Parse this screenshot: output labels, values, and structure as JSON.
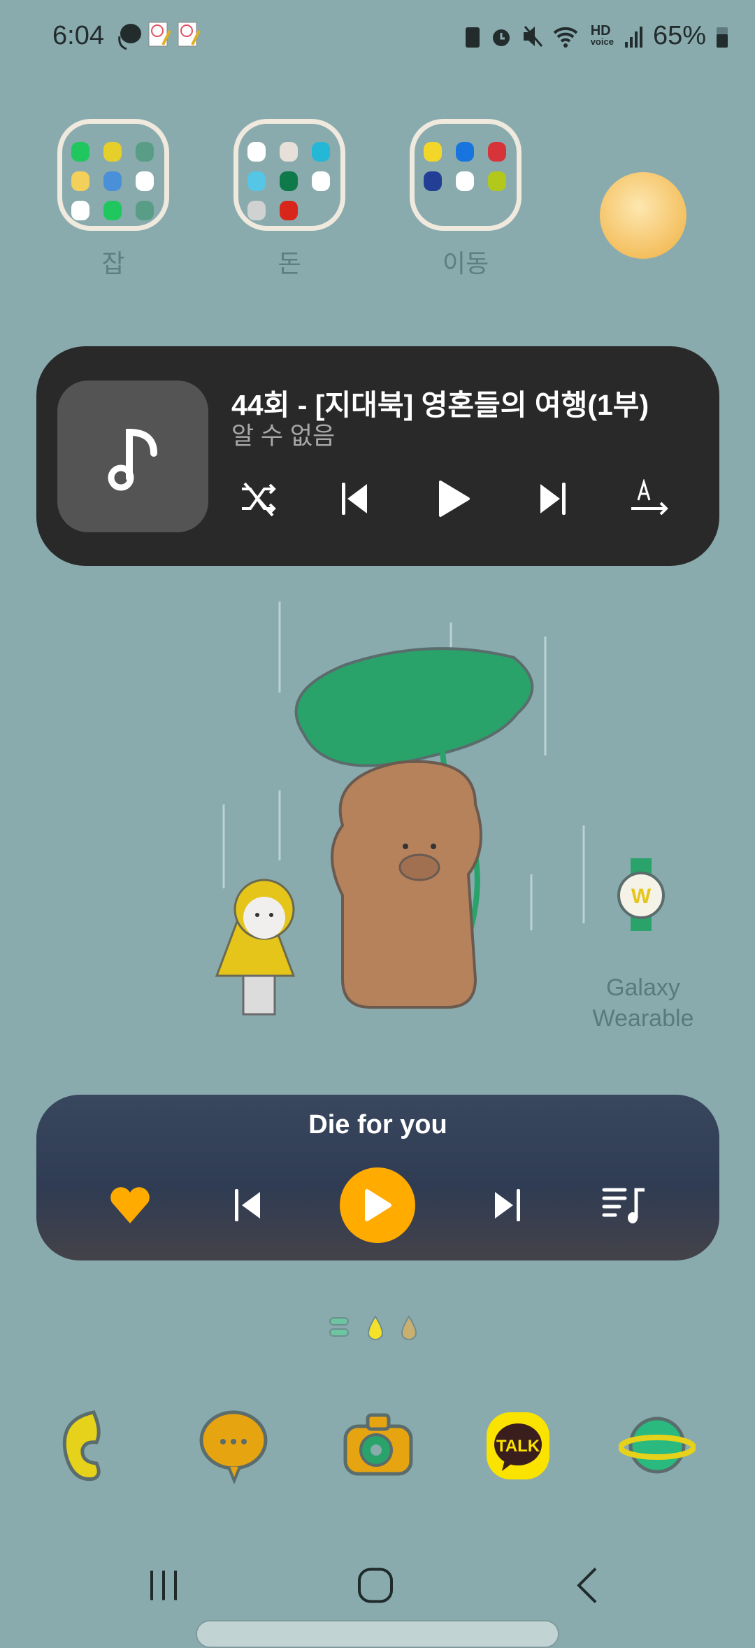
{
  "status_bar": {
    "time": "6:04",
    "battery": "65%",
    "hd_voice": "HD",
    "hd_voice_sub": "voice",
    "icons": [
      "phone-message-icon",
      "memo-icon",
      "memo-icon",
      "battery-saver-icon",
      "alarm-icon",
      "mute-icon",
      "wifi-icon",
      "hd-voice-icon",
      "signal-icon",
      "battery-icon"
    ]
  },
  "folders": [
    {
      "label": "잡",
      "apps": [
        "#1fc75e",
        "#e6cf2a",
        "#5a9d87",
        "#f3d05a",
        "#4a90d8",
        "#ffffff",
        "#ffffff",
        "#1fc75e",
        "#5a9d87"
      ]
    },
    {
      "label": "돈",
      "apps": [
        "#ffffff",
        "#e7e0d8",
        "#25b8d6",
        "#55c6e6",
        "#0f7a49",
        "#ffffff",
        "#cfd2d0",
        "#d8261c"
      ]
    },
    {
      "label": "이동",
      "apps": [
        "#f3d62a",
        "#1875e0",
        "#d7343a",
        "#233f95",
        "#ffffff",
        "#b2c91c"
      ]
    }
  ],
  "media_widget": {
    "title": "44회 - [지대북] 영혼들의 여행(1부)",
    "artist": "알 수 없음"
  },
  "galaxy_wearable": {
    "label_line1": "Galaxy",
    "label_line2": "Wearable"
  },
  "music_widget": {
    "title": "Die for you",
    "accent": "#ffab00"
  },
  "dock": {
    "talk_label": "TALK",
    "apps": [
      "phone",
      "messages",
      "camera",
      "kakaotalk",
      "internet"
    ]
  },
  "page_indicator": {
    "pages": 3,
    "current": 1
  }
}
